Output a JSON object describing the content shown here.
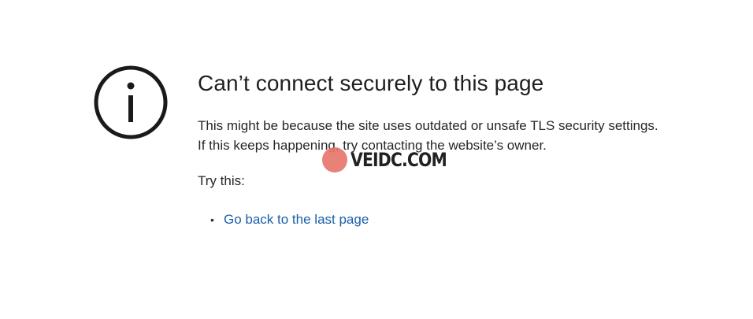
{
  "error": {
    "icon": "info-icon",
    "title": "Can’t connect securely to this page",
    "description": "This might be because the site uses outdated or unsafe TLS security settings. If this keeps happening, try contacting the website’s owner.",
    "try_label": "Try this:",
    "suggestions": [
      {
        "label": "Go back to the last page"
      }
    ]
  },
  "watermark": {
    "logo_text": "VEIDC",
    "text": "VEIDC.COM"
  },
  "colors": {
    "link": "#1a5fa8",
    "text": "#262626",
    "watermark_logo": "#e8736a"
  }
}
